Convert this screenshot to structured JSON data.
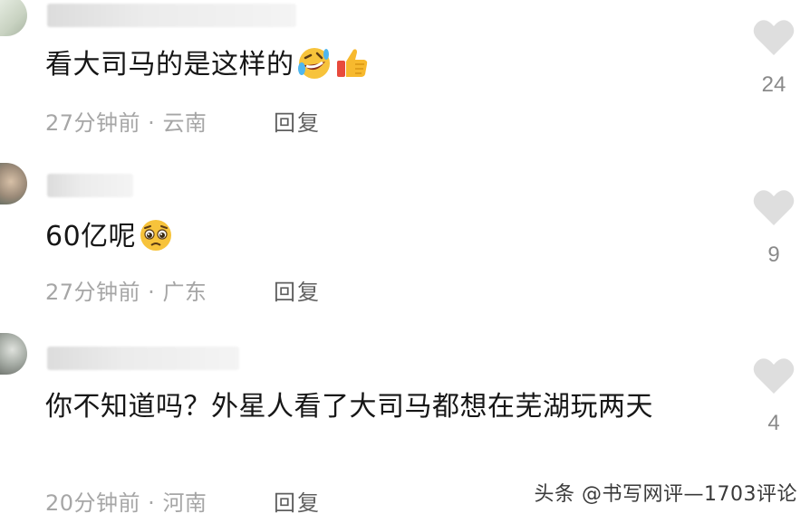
{
  "comments": [
    {
      "text": "看大司马的是这样的",
      "emojis": [
        "rolling-on-floor-laughing-emoji",
        "thumbs-up-emoji"
      ],
      "time": "27分钟前",
      "location": "云南",
      "reply_label": "回复",
      "likes": "24"
    },
    {
      "text": "60亿呢",
      "emojis": [
        "pleading-face-emoji"
      ],
      "time": "27分钟前",
      "location": "广东",
      "reply_label": "回复",
      "likes": "9"
    },
    {
      "text": "你不知道吗？外星人看了大司马都想在芜湖玩两天",
      "emojis": [],
      "time": "20分钟前",
      "location": "河南",
      "reply_label": "回复",
      "likes": "4"
    }
  ],
  "meta_separator": " · ",
  "watermark": "头条 @书写网评—1703评论",
  "colors": {
    "heart": "#dedede",
    "meta_text": "#a6a6a6",
    "reply_text": "#5f5f5f",
    "body_text": "#161616"
  }
}
